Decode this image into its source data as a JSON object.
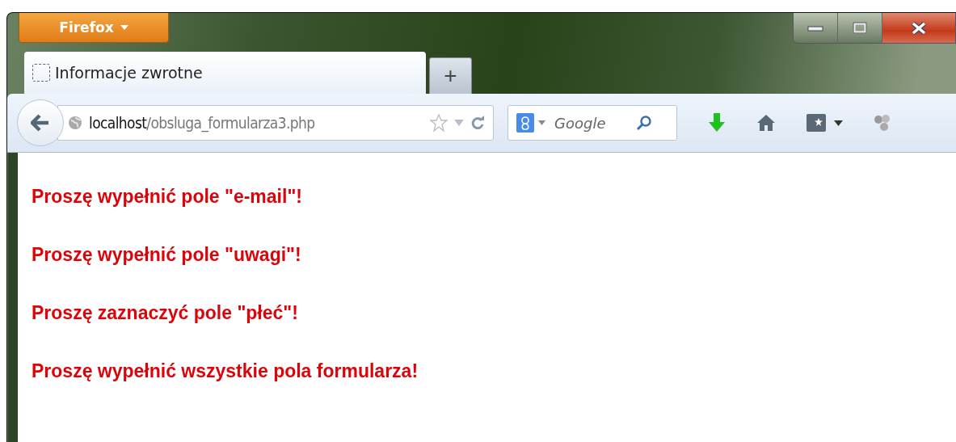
{
  "app_button": {
    "label": "Firefox"
  },
  "tabs": [
    {
      "label": "Informacje zwrotne",
      "selected": true
    }
  ],
  "new_tab": {
    "label": "+"
  },
  "address_bar": {
    "host": "localhost",
    "path": "/obsluga_formularza3.php"
  },
  "search": {
    "placeholder": "Google"
  },
  "messages": [
    "Proszę wypełnić pole \"e-mail\"!",
    "Proszę wypełnić pole \"uwagi\"!",
    "Proszę zaznaczyć pole \"płeć\"!",
    "Proszę wypełnić wszystkie pola formularza!"
  ]
}
